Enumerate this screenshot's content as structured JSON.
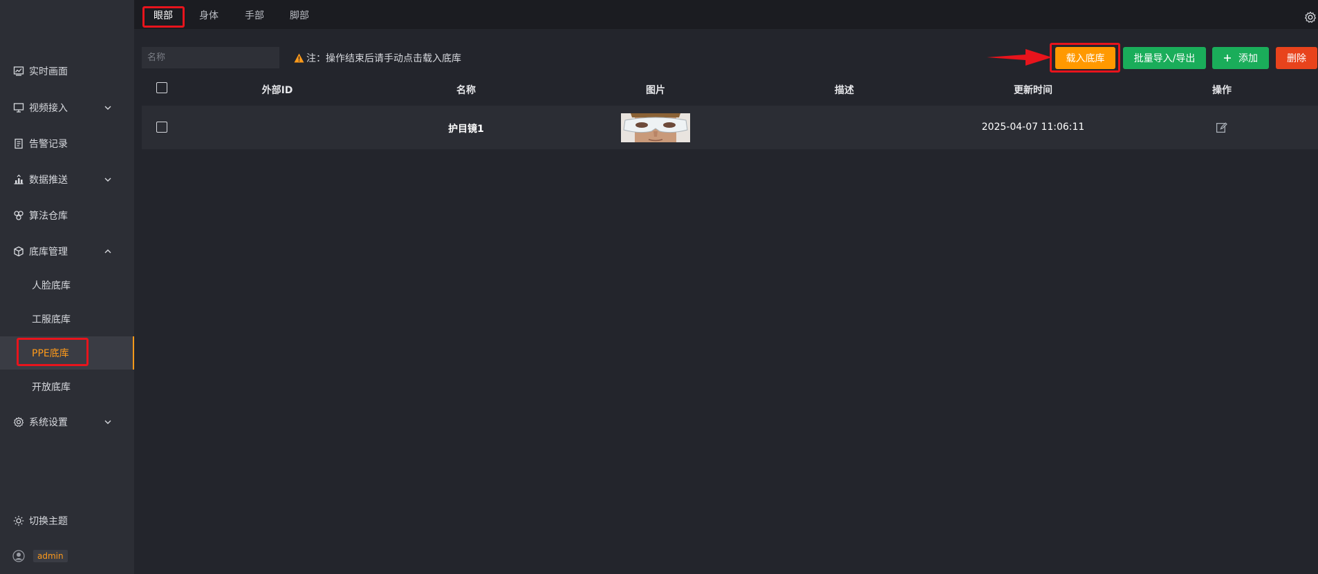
{
  "sidebar": {
    "items": [
      {
        "label": "实时画面",
        "icon": "monitor-chart-icon"
      },
      {
        "label": "视频接入",
        "icon": "screen-icon",
        "chevron": "down"
      },
      {
        "label": "告警记录",
        "icon": "document-icon"
      },
      {
        "label": "数据推送",
        "icon": "upload-chart-icon",
        "chevron": "down"
      },
      {
        "label": "算法仓库",
        "icon": "algorithm-icon"
      },
      {
        "label": "底库管理",
        "icon": "box-icon",
        "chevron": "up"
      },
      {
        "label": "系统设置",
        "icon": "gear-icon",
        "chevron": "down"
      }
    ],
    "sub_items": [
      {
        "label": "人脸底库"
      },
      {
        "label": "工服底库"
      },
      {
        "label": "PPE底库",
        "active": true
      },
      {
        "label": "开放底库"
      }
    ],
    "theme_label": "切换主题",
    "user": "admin"
  },
  "tabs": [
    {
      "label": "眼部",
      "active": true
    },
    {
      "label": "身体"
    },
    {
      "label": "手部"
    },
    {
      "label": "脚部"
    }
  ],
  "toolbar": {
    "search_placeholder": "名称",
    "note": "注：操作结束后请手动点击载入底库",
    "load_label": "载入底库",
    "import_export_label": "批量导入/导出",
    "add_label": "添加",
    "delete_label": "删除"
  },
  "table": {
    "columns": [
      "外部ID",
      "名称",
      "图片",
      "描述",
      "更新时间",
      "操作"
    ],
    "rows": [
      {
        "external_id": "",
        "name": "护目镜1",
        "description": "",
        "updated": "2025-04-07 11:06:11"
      }
    ]
  },
  "colors": {
    "accent": "#ff9a1a",
    "load_button": "#ff9900",
    "green_button": "#1aad5a",
    "delete_button": "#e8431c",
    "highlight": "#e8141c"
  }
}
